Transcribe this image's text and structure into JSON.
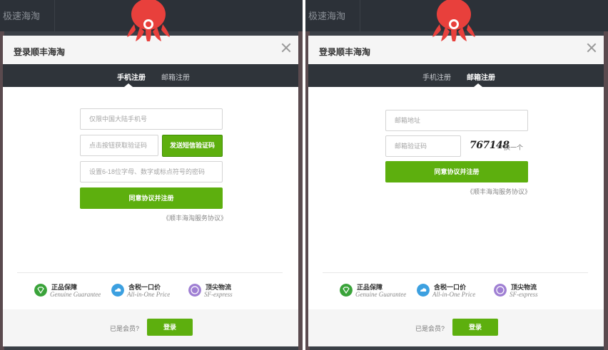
{
  "background": {
    "title": "极速海淘"
  },
  "modal": {
    "title": "登录顺丰海淘"
  },
  "tabs": [
    {
      "label": "手机注册"
    },
    {
      "label": "邮箱注册"
    }
  ],
  "phone_form": {
    "phone_placeholder": "仅限中国大陆手机号",
    "code_placeholder": "点击按钮获取验证码",
    "send_code_label": "发送短信验证码",
    "password_placeholder": "设置6-18位字母、数字或标点符号的密码",
    "submit_label": "同意协议并注册",
    "agreement_link": "《顺丰海淘服务协议》"
  },
  "email_form": {
    "email_placeholder": "邮箱地址",
    "code_placeholder": "邮箱验证码",
    "captcha_text": "767148",
    "refresh_label": "换一个",
    "submit_label": "同意协议并注册",
    "agreement_link": "《顺丰海淘服务协议》"
  },
  "features": [
    {
      "name": "正品保障",
      "subtitle": "Genuine Guarantee",
      "icon": "diamond-icon",
      "color": "#3aa33a"
    },
    {
      "name": "含税一口价",
      "subtitle": "All-in-One Price",
      "icon": "cloud-price-icon",
      "color": "#3ca0e0"
    },
    {
      "name": "顶尖物流",
      "subtitle": "SF-express",
      "icon": "sf-logistics-icon",
      "color": "#9f7fd3"
    }
  ],
  "footer": {
    "member_text": "已是会员?",
    "login_label": "登录"
  },
  "colors": {
    "accent_green": "#5daf0e",
    "tab_bar": "#2f343a",
    "mascot_red": "#e8403c"
  }
}
